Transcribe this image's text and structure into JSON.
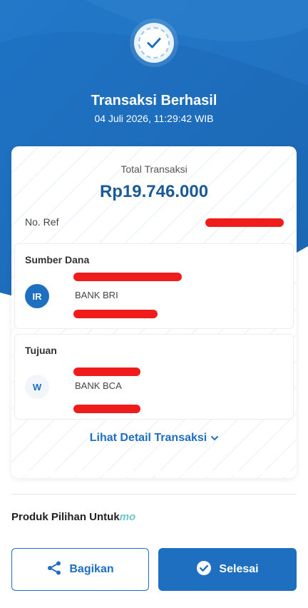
{
  "header": {
    "title": "Transaksi Berhasil",
    "datetime": "04 Juli 2026, 11:29:42 WIB"
  },
  "receipt": {
    "total_label": "Total Transaksi",
    "total_amount": "Rp19.746.000",
    "ref_label": "No. Ref"
  },
  "source": {
    "heading": "Sumber Dana",
    "initials": "IR",
    "bank": "BANK BRI"
  },
  "destination": {
    "heading": "Tujuan",
    "initials": "W",
    "bank": "BANK BCA"
  },
  "detail_link": "Lihat Detail Transaksi",
  "produk": {
    "label": "Produk Pilihan Untuk",
    "brand": "mo"
  },
  "buttons": {
    "share": "Bagikan",
    "done": "Selesai"
  },
  "colors": {
    "primary": "#1e6fc0",
    "primary_dark": "#1a5a96",
    "redaction": "#f01c1c",
    "brand_accent": "#6fc6c9"
  },
  "icons": {
    "success": "check-circle-icon",
    "chevron": "chevron-down-icon",
    "share": "share-icon",
    "done": "check-circle-icon"
  }
}
